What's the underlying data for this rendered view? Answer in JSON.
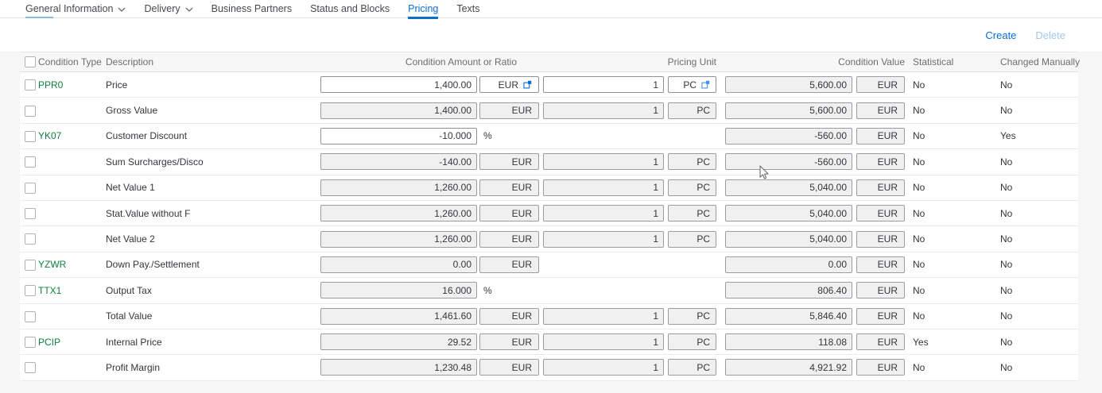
{
  "tabs": [
    {
      "label": "General Information",
      "has_dropdown": true,
      "active": false
    },
    {
      "label": "Delivery",
      "has_dropdown": true,
      "active": false
    },
    {
      "label": "Business Partners",
      "has_dropdown": false,
      "active": false
    },
    {
      "label": "Status and Blocks",
      "has_dropdown": false,
      "active": false
    },
    {
      "label": "Pricing",
      "has_dropdown": false,
      "active": true
    },
    {
      "label": "Texts",
      "has_dropdown": false,
      "active": false
    }
  ],
  "toolbar": {
    "create_label": "Create",
    "delete_label": "Delete"
  },
  "table": {
    "columns": {
      "condition_type": "Condition Type",
      "description": "Description",
      "amount": "Condition Amount or Ratio",
      "pricing_unit": "Pricing Unit",
      "condition_value": "Condition Value",
      "statistical": "Statistical",
      "changed_manually": "Changed Manually"
    },
    "rows": [
      {
        "type": "PPR0",
        "description": "Price",
        "amount": "1,400.00",
        "amount_editable": true,
        "currency": "EUR",
        "currency_style": "editable",
        "currency_icon": true,
        "qty": "1",
        "qty_editable": true,
        "unit": "PC",
        "unit_editable": true,
        "unit_icon": true,
        "value": "5,600.00",
        "value_currency": "EUR",
        "statistical": "No",
        "changed": "No"
      },
      {
        "type": "",
        "description": "Gross Value",
        "amount": "1,400.00",
        "amount_editable": false,
        "currency": "EUR",
        "currency_style": "readonly",
        "currency_icon": false,
        "qty": "1",
        "qty_editable": false,
        "unit": "PC",
        "unit_editable": false,
        "unit_icon": false,
        "value": "5,600.00",
        "value_currency": "EUR",
        "statistical": "No",
        "changed": "No"
      },
      {
        "type": "YK07",
        "description": "Customer Discount",
        "amount": "-10.000",
        "amount_editable": true,
        "currency": "%",
        "currency_style": "percent",
        "currency_icon": false,
        "qty": null,
        "qty_editable": false,
        "unit": null,
        "unit_editable": false,
        "unit_icon": false,
        "value": "-560.00",
        "value_currency": "EUR",
        "statistical": "No",
        "changed": "Yes"
      },
      {
        "type": "",
        "description": "Sum Surcharges/Disco",
        "amount": "-140.00",
        "amount_editable": false,
        "currency": "EUR",
        "currency_style": "readonly",
        "currency_icon": false,
        "qty": "1",
        "qty_editable": false,
        "unit": "PC",
        "unit_editable": false,
        "unit_icon": false,
        "value": "-560.00",
        "value_currency": "EUR",
        "statistical": "No",
        "changed": "No"
      },
      {
        "type": "",
        "description": "Net Value 1",
        "amount": "1,260.00",
        "amount_editable": false,
        "currency": "EUR",
        "currency_style": "readonly",
        "currency_icon": false,
        "qty": "1",
        "qty_editable": false,
        "unit": "PC",
        "unit_editable": false,
        "unit_icon": false,
        "value": "5,040.00",
        "value_currency": "EUR",
        "statistical": "No",
        "changed": "No"
      },
      {
        "type": "",
        "description": "Stat.Value without F",
        "amount": "1,260.00",
        "amount_editable": false,
        "currency": "EUR",
        "currency_style": "readonly",
        "currency_icon": false,
        "qty": "1",
        "qty_editable": false,
        "unit": "PC",
        "unit_editable": false,
        "unit_icon": false,
        "value": "5,040.00",
        "value_currency": "EUR",
        "statistical": "No",
        "changed": "No"
      },
      {
        "type": "",
        "description": "Net Value 2",
        "amount": "1,260.00",
        "amount_editable": false,
        "currency": "EUR",
        "currency_style": "readonly",
        "currency_icon": false,
        "qty": "1",
        "qty_editable": false,
        "unit": "PC",
        "unit_editable": false,
        "unit_icon": false,
        "value": "5,040.00",
        "value_currency": "EUR",
        "statistical": "No",
        "changed": "No"
      },
      {
        "type": "YZWR",
        "description": "Down Pay./Settlement",
        "amount": "0.00",
        "amount_editable": false,
        "currency": "EUR",
        "currency_style": "readonly",
        "currency_icon": false,
        "qty": null,
        "qty_editable": false,
        "unit": null,
        "unit_editable": false,
        "unit_icon": false,
        "value": "0.00",
        "value_currency": "EUR",
        "statistical": "No",
        "changed": "No"
      },
      {
        "type": "TTX1",
        "description": "Output Tax",
        "amount": "16.000",
        "amount_editable": false,
        "currency": "%",
        "currency_style": "percent",
        "currency_icon": false,
        "qty": null,
        "qty_editable": false,
        "unit": null,
        "unit_editable": false,
        "unit_icon": false,
        "value": "806.40",
        "value_currency": "EUR",
        "statistical": "No",
        "changed": "No"
      },
      {
        "type": "",
        "description": "Total Value",
        "amount": "1,461.60",
        "amount_editable": false,
        "currency": "EUR",
        "currency_style": "readonly",
        "currency_icon": false,
        "qty": "1",
        "qty_editable": false,
        "unit": "PC",
        "unit_editable": false,
        "unit_icon": false,
        "value": "5,846.40",
        "value_currency": "EUR",
        "statistical": "No",
        "changed": "No"
      },
      {
        "type": "PCIP",
        "description": "Internal Price",
        "amount": "29.52",
        "amount_editable": false,
        "currency": "EUR",
        "currency_style": "readonly",
        "currency_icon": false,
        "qty": "1",
        "qty_editable": false,
        "unit": "PC",
        "unit_editable": false,
        "unit_icon": false,
        "value": "118.08",
        "value_currency": "EUR",
        "statistical": "Yes",
        "changed": "No"
      },
      {
        "type": "",
        "description": "Profit Margin",
        "amount": "1,230.48",
        "amount_editable": false,
        "currency": "EUR",
        "currency_style": "readonly",
        "currency_icon": false,
        "qty": "1",
        "qty_editable": false,
        "unit": "PC",
        "unit_editable": false,
        "unit_icon": false,
        "value": "4,921.92",
        "value_currency": "EUR",
        "statistical": "No",
        "changed": "No"
      }
    ]
  },
  "colors": {
    "accent_blue": "#0a6ed1",
    "link_green": "#107e3e",
    "disabled_blue": "#a5c6e8",
    "header_bg": "#f7f7f8",
    "page_bg": "#f6f6f7"
  }
}
